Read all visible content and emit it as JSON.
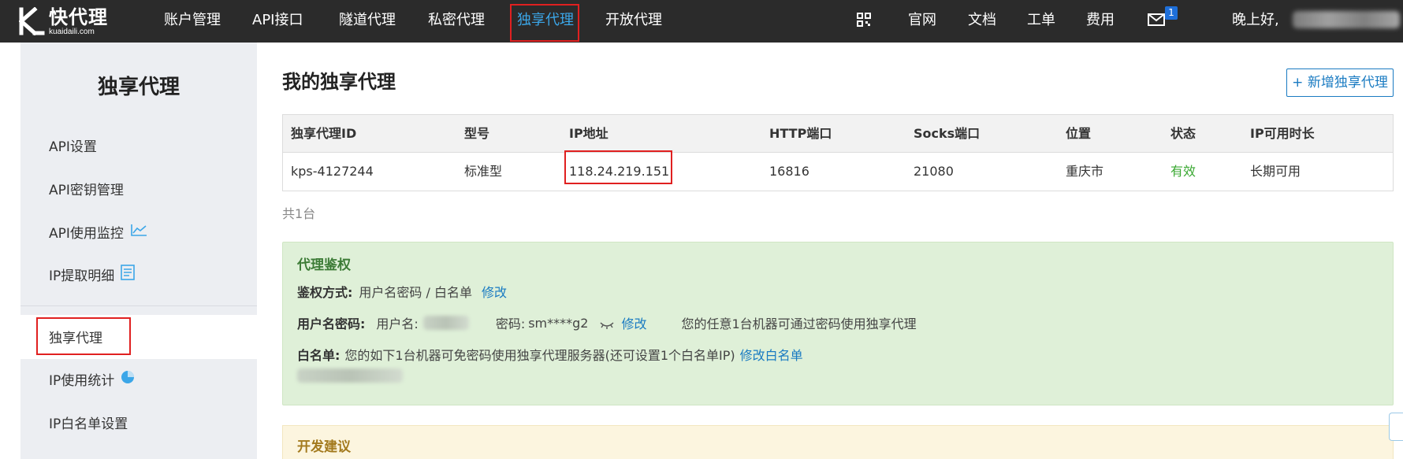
{
  "brand": {
    "name_cn": "快代理",
    "name_en": "kuaidaili.com"
  },
  "nav": {
    "items": [
      "账户管理",
      "API接口",
      "隧道代理",
      "私密代理",
      "独享代理",
      "开放代理"
    ],
    "active": "独享代理",
    "right": [
      "官网",
      "文档",
      "工单",
      "费用"
    ],
    "mail_count": "1",
    "greeting": "晚上好,"
  },
  "sidebar": {
    "title": "独享代理",
    "items": [
      "API设置",
      "API密钥管理",
      "API使用监控",
      "IP提取明细",
      "独享代理",
      "IP使用统计",
      "IP白名单设置"
    ],
    "active": "独享代理"
  },
  "main": {
    "title": "我的独享代理",
    "add_button": "+ 新增独享代理",
    "table": {
      "headers": [
        "独享代理ID",
        "型号",
        "IP地址",
        "HTTP端口",
        "Socks端口",
        "位置",
        "状态",
        "IP可用时长"
      ],
      "rows": [
        [
          "kps-4127244",
          "标准型",
          "118.24.219.151",
          "16816",
          "21080",
          "重庆市",
          "有效",
          "长期可用"
        ]
      ]
    },
    "count": "共1台"
  },
  "auth": {
    "title": "代理鉴权",
    "method_label": "鉴权方式:",
    "method_value": "用户名密码 / 白名单",
    "method_link": "修改",
    "userpass_label": "用户名密码:",
    "username_label": "用户名:",
    "password_label": "密码:",
    "password_value": "sm****g2",
    "userpass_link": "修改",
    "userpass_note": "您的任意1台机器可通过密码使用独享代理",
    "whitelist_label": "白名单:",
    "whitelist_note": "您的如下1台机器可免密码使用独享代理服务器(还可设置1个白名单IP)",
    "whitelist_link": "修改白名单"
  },
  "dev": {
    "title": "开发建议"
  },
  "colors": {
    "nav_bg": "#2b2b2b",
    "accent": "#3ba6e8",
    "link": "#1a7bc2",
    "highlight": "#e02020",
    "ok": "#3aa832"
  }
}
